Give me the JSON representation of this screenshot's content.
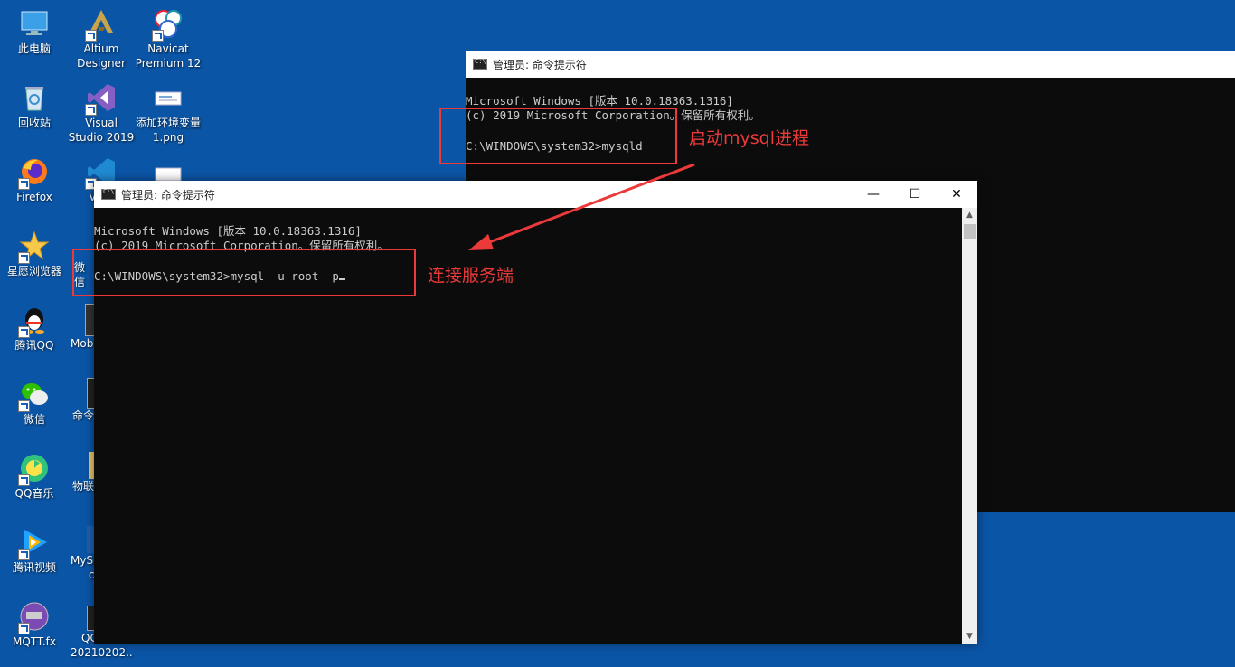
{
  "desktop": {
    "icons": [
      {
        "label": "此电脑",
        "icon": "computer-icon"
      },
      {
        "label": "Altium Designer",
        "icon": "altium-icon"
      },
      {
        "label": "Navicat Premium 12",
        "icon": "navicat-icon"
      },
      {
        "label": "回收站",
        "icon": "recycle-bin-icon"
      },
      {
        "label": "Visual Studio 2019",
        "icon": "visual-studio-icon"
      },
      {
        "label": "添加环境变量1.png",
        "icon": "image-file-icon"
      },
      {
        "label": "Firefox",
        "icon": "firefox-icon"
      },
      {
        "label": "星愿浏览器",
        "icon": "star-browser-icon"
      },
      {
        "label": "腾讯QQ",
        "icon": "qq-icon"
      },
      {
        "label": "微信",
        "icon": "wechat-icon"
      },
      {
        "label": "QQ音乐",
        "icon": "qq-music-icon"
      },
      {
        "label": "腾讯视频",
        "icon": "tencent-video-icon"
      },
      {
        "label": "MQTT.fx",
        "icon": "mqtt-icon"
      }
    ],
    "partial": {
      "vs_code": "Vi St",
      "wechat2": "微信",
      "mob": "Mob",
      "cmd": "命令",
      "wulian": "物联",
      "mys": "MyS",
      "mys2": "c",
      "qt": "QC",
      "qt2": "20210202..."
    }
  },
  "window_back": {
    "title": "管理员: 命令提示符",
    "lines": [
      "Microsoft Windows [版本 10.0.18363.1316]",
      "(c) 2019 Microsoft Corporation。保留所有权利。",
      "",
      "C:\\WINDOWS\\system32>mysqld"
    ]
  },
  "window_front": {
    "title": "管理员: 命令提示符",
    "minimize": "—",
    "maximize": "☐",
    "close": "✕",
    "lines": [
      "Microsoft Windows [版本 10.0.18363.1316]",
      "(c) 2019 Microsoft Corporation。保留所有权利。",
      "",
      "C:\\WINDOWS\\system32>mysql -u root -p"
    ]
  },
  "annotations": {
    "start_label": "启动mysql进程",
    "connect_label": "连接服务端",
    "color": "#ec3a3a"
  }
}
